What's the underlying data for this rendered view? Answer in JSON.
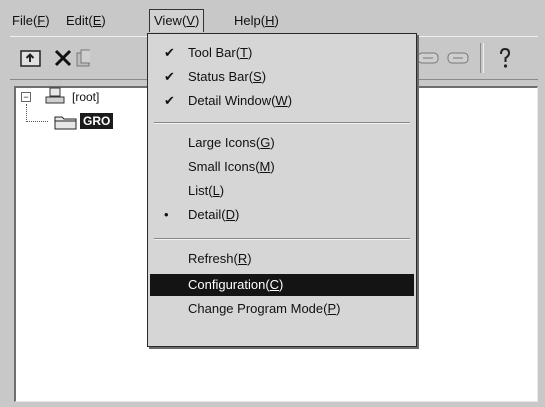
{
  "menubar": {
    "file": {
      "text": "File(",
      "key": "F",
      "close": ")"
    },
    "edit": {
      "text": "Edit(",
      "key": "E",
      "close": ")"
    },
    "view": {
      "text": "View(",
      "key": "V",
      "close": ")"
    },
    "help": {
      "text": "Help(",
      "key": "H",
      "close": ")"
    }
  },
  "toolbar": {
    "icons": [
      "up-folder-icon",
      "delete-icon",
      "copy-icon",
      "view-icon",
      "view-icon",
      "help-icon"
    ]
  },
  "tree": {
    "root_label": "[root]",
    "child_label": "GRO"
  },
  "view_menu": {
    "items": [
      {
        "text": "Tool Bar(",
        "key": "T",
        "close": ")",
        "mark": "✔"
      },
      {
        "text": "Status Bar(",
        "key": "S",
        "close": ")",
        "mark": "✔"
      },
      {
        "text": "Detail Window(",
        "key": "W",
        "close": ")",
        "mark": "✔"
      },
      {
        "text": "Large Icons(",
        "key": "G",
        "close": ")",
        "mark": ""
      },
      {
        "text": "Small Icons(",
        "key": "M",
        "close": ")",
        "mark": ""
      },
      {
        "text": "List(",
        "key": "L",
        "close": ")",
        "mark": ""
      },
      {
        "text": "Detail(",
        "key": "D",
        "close": ")",
        "mark": "•"
      },
      {
        "text": "Refresh(",
        "key": "R",
        "close": ")",
        "mark": ""
      },
      {
        "text": "Configuration(",
        "key": "C",
        "close": ")",
        "mark": ""
      },
      {
        "text": "Change Program Mode(",
        "key": "P",
        "close": ")",
        "mark": ""
      }
    ],
    "highlighted_index": 8
  },
  "colors": {
    "highlight_bg": "#141414",
    "menu_bg": "#d6d6d6",
    "window_bg": "#c8c8c8"
  }
}
